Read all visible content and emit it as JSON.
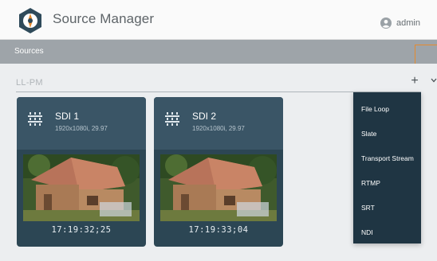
{
  "app": {
    "title": "Source Manager"
  },
  "user": {
    "name": "admin"
  },
  "sources_bar": {
    "label": "Sources"
  },
  "group": {
    "name": "LL-PM",
    "add_label": "+"
  },
  "sources": [
    {
      "name": "SDI 1",
      "format": "1920x1080i, 29.97",
      "timecode": "17:19:32;25",
      "icon": "sdi-connector-icon"
    },
    {
      "name": "SDI 2",
      "format": "1920x1080i, 29.97",
      "timecode": "17:19:33;04",
      "icon": "sdi-connector-icon"
    }
  ],
  "add_menu": {
    "items": [
      "File Loop",
      "Slate",
      "Transport Stream",
      "RTMP",
      "SRT",
      "NDI"
    ]
  },
  "colors": {
    "accent": "#e58a2e",
    "sources_bar": "#9ea4a9",
    "card": "#2c4654",
    "menu": "#1f3543"
  }
}
